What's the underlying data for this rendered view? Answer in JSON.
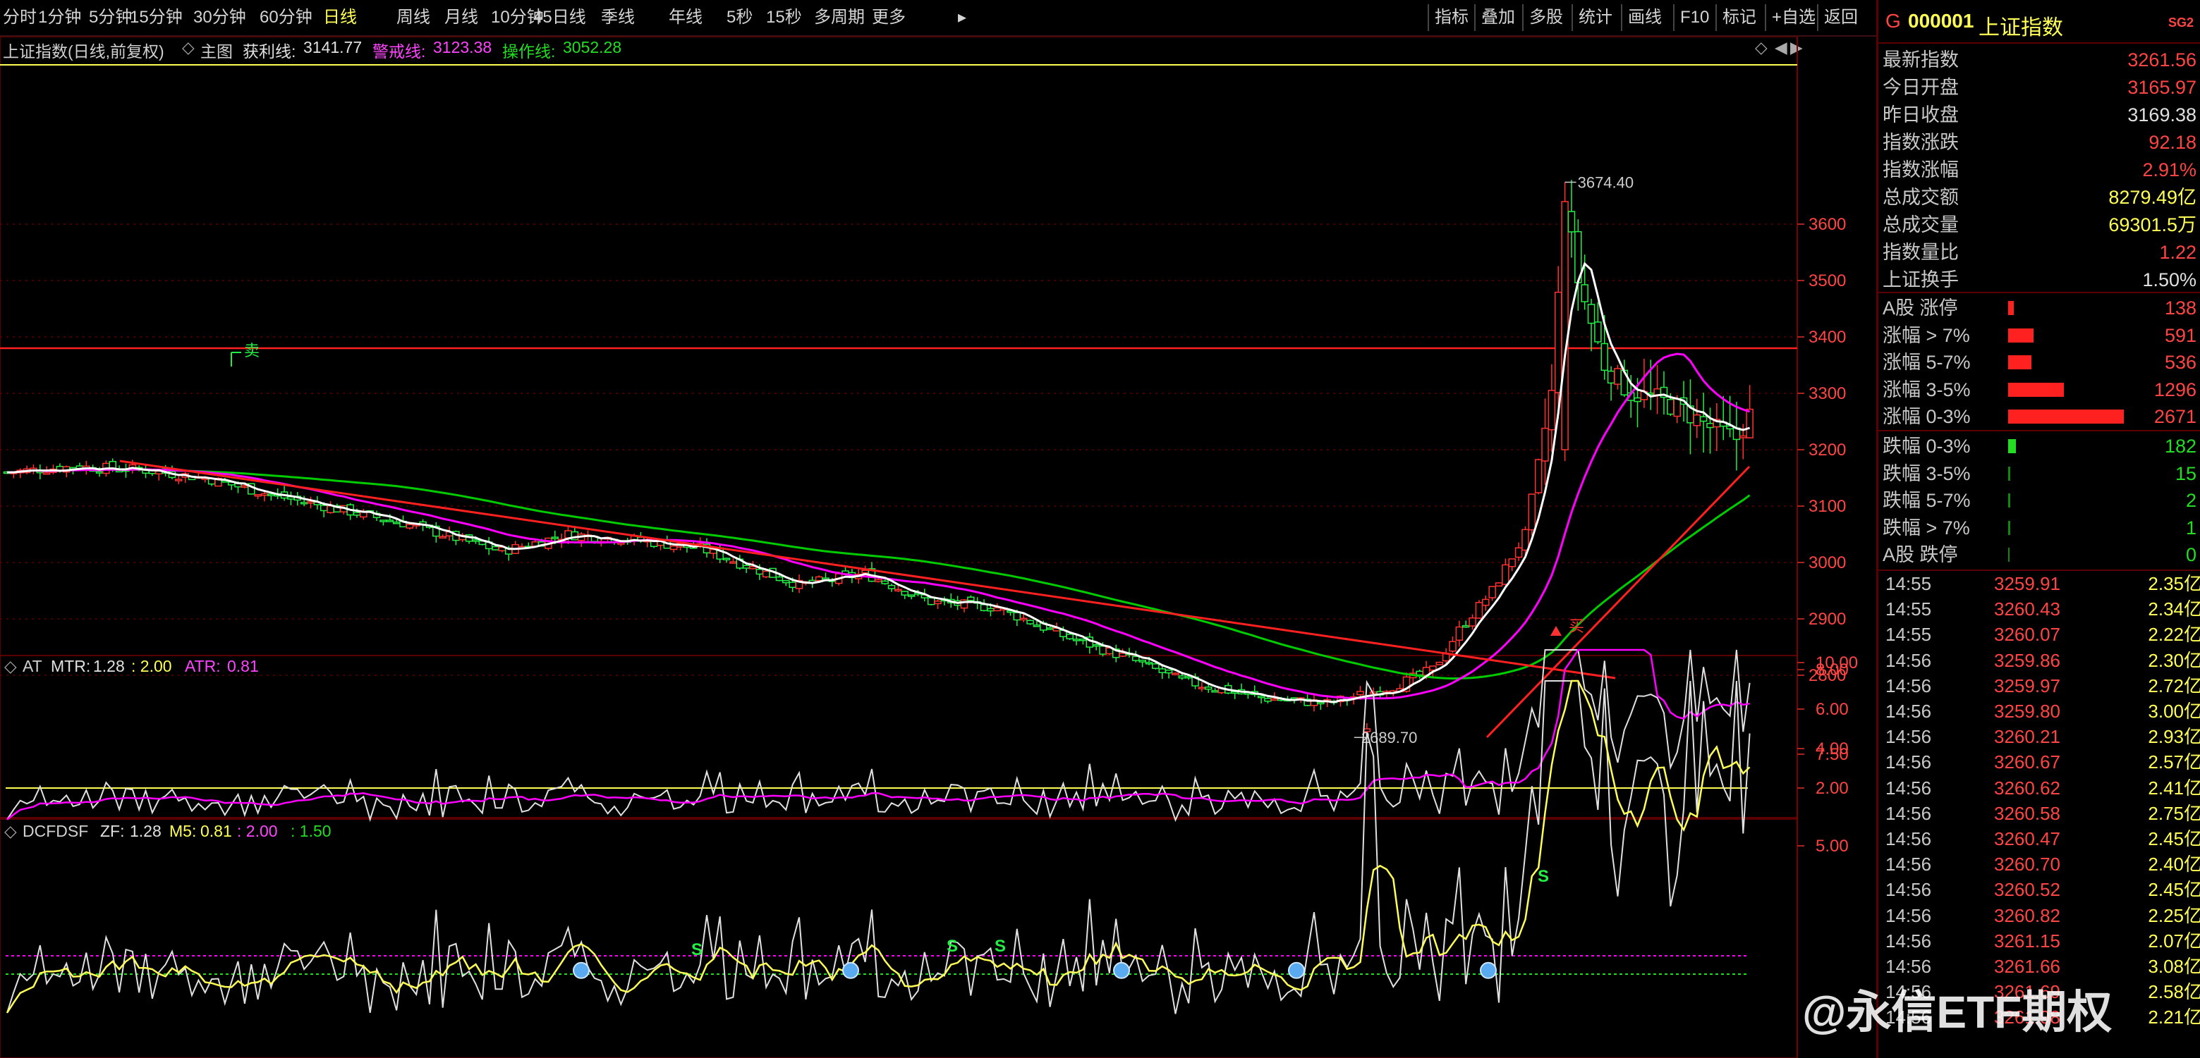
{
  "toolbar": {
    "periods": [
      "分时",
      "1分钟",
      "5分钟",
      "15分钟",
      "30分钟",
      "60分钟",
      "日线",
      "周线",
      "月线",
      "10分钟",
      "45日线",
      "季线",
      "年线",
      "5秒",
      "15秒",
      "多周期",
      "更多"
    ],
    "active": "日线",
    "more_arrow": "▸",
    "tools": [
      "指标",
      "叠加",
      "多股",
      "统计",
      "画线",
      "F10",
      "标记",
      "+自选",
      "返回"
    ]
  },
  "main_header": {
    "name": "上证指数(日线,前复权)",
    "chart_label": "主图",
    "profit_label": "获利线:",
    "profit_value": "3141.77",
    "warn_label": "警戒线:",
    "warn_value": "3123.38",
    "op_label": "操作线:",
    "op_value": "3052.28",
    "collapse_glyph": "◇",
    "diamond_glyph": "◇",
    "left_glyph": "◀",
    "right_glyph": "▶"
  },
  "colors": {
    "up": "#ff3232",
    "down": "#00e0e0",
    "ma_white": "#ffffff",
    "ma_magenta": "#ff00ff",
    "ma_green": "#00cc00",
    "red_line": "#ff2020",
    "yellow": "#ffff55",
    "grid": "#5a0000"
  },
  "main_axis": {
    "ticks": [
      "3600",
      "3500",
      "3400",
      "3300",
      "3200",
      "3100",
      "3000",
      "2900",
      "2800"
    ]
  },
  "annotations": {
    "high": "3674.40",
    "low": "2689.70",
    "sell": "卖",
    "buy": "买"
  },
  "at_panel": {
    "title": "AT",
    "mtr_label": "MTR:",
    "mtr_value": "1.28",
    "mtr_sep": ": 2.00",
    "atr_label": "ATR:",
    "atr_value": "0.81",
    "ticks": [
      "8.00",
      "6.00",
      "4.00",
      "2.00"
    ]
  },
  "dcf_panel": {
    "title": "DCFDSF",
    "zf_label": "ZF:",
    "zf_value": "1.28",
    "m5_label": "M5:",
    "m5_value": "0.81",
    "extra1": ": 2.00",
    "extra2": ": 1.50",
    "ticks": [
      "10.00",
      "7.50",
      "5.00"
    ],
    "signal": "S"
  },
  "quote": {
    "prefix": "G",
    "code": "000001",
    "name": "上证指数",
    "badge": "SG2",
    "rows": [
      {
        "label": "最新指数",
        "value": "3261.56",
        "color": "#ff4444"
      },
      {
        "label": "今日开盘",
        "value": "3165.97",
        "color": "#ff4444"
      },
      {
        "label": "昨日收盘",
        "value": "3169.38",
        "color": "#e0e0e0"
      },
      {
        "label": "指数涨跌",
        "value": "92.18",
        "color": "#ff4444"
      },
      {
        "label": "指数涨幅",
        "value": "2.91%",
        "color": "#ff4444"
      },
      {
        "label": "总成交额",
        "value": "8279.49亿",
        "color": "#ffff55"
      },
      {
        "label": "总成交量",
        "value": "69301.5万",
        "color": "#ffff55"
      },
      {
        "label": "指数量比",
        "value": "1.22",
        "color": "#ff4444"
      },
      {
        "label": "上证换手",
        "value": "1.50%",
        "color": "#e0e0e0"
      }
    ],
    "breadth_up": [
      {
        "label": "A股 涨停",
        "value": "138",
        "ratio": 0.05
      },
      {
        "label": "涨幅 > 7%",
        "value": "591",
        "ratio": 0.22
      },
      {
        "label": "涨幅 5-7%",
        "value": "536",
        "ratio": 0.2
      },
      {
        "label": "涨幅 3-5%",
        "value": "1296",
        "ratio": 0.48
      },
      {
        "label": "涨幅 0-3%",
        "value": "2671",
        "ratio": 1.0
      }
    ],
    "breadth_down": [
      {
        "label": "跌幅 0-3%",
        "value": "182",
        "ratio": 0.07
      },
      {
        "label": "跌幅 3-5%",
        "value": "15",
        "ratio": 0.006
      },
      {
        "label": "跌幅 5-7%",
        "value": "2",
        "ratio": 0.001
      },
      {
        "label": "跌幅 > 7%",
        "value": "1",
        "ratio": 0.0005
      },
      {
        "label": "A股 跌停",
        "value": "0",
        "ratio": 0
      }
    ],
    "ticks": [
      {
        "time": "14:55",
        "price": "3259.91",
        "vol": "2.35亿"
      },
      {
        "time": "14:55",
        "price": "3260.43",
        "vol": "2.34亿"
      },
      {
        "time": "14:55",
        "price": "3260.07",
        "vol": "2.22亿"
      },
      {
        "time": "14:56",
        "price": "3259.86",
        "vol": "2.30亿"
      },
      {
        "time": "14:56",
        "price": "3259.97",
        "vol": "2.72亿"
      },
      {
        "time": "14:56",
        "price": "3259.80",
        "vol": "3.00亿"
      },
      {
        "time": "14:56",
        "price": "3260.21",
        "vol": "2.93亿"
      },
      {
        "time": "14:56",
        "price": "3260.67",
        "vol": "2.57亿"
      },
      {
        "time": "14:56",
        "price": "3260.62",
        "vol": "2.41亿"
      },
      {
        "time": "14:56",
        "price": "3260.58",
        "vol": "2.75亿"
      },
      {
        "time": "14:56",
        "price": "3260.47",
        "vol": "2.45亿"
      },
      {
        "time": "14:56",
        "price": "3260.70",
        "vol": "2.40亿"
      },
      {
        "time": "14:56",
        "price": "3260.52",
        "vol": "2.45亿"
      },
      {
        "time": "14:56",
        "price": "3260.82",
        "vol": "2.25亿"
      },
      {
        "time": "14:56",
        "price": "3261.15",
        "vol": "2.07亿"
      },
      {
        "time": "14:56",
        "price": "3261.66",
        "vol": "3.08亿"
      },
      {
        "time": "14:56",
        "price": "3261.69",
        "vol": "2.58亿"
      },
      {
        "time": "14:56",
        "price": "3261.98",
        "vol": "2.21亿"
      }
    ]
  },
  "watermark": "@永信ETF期权"
}
